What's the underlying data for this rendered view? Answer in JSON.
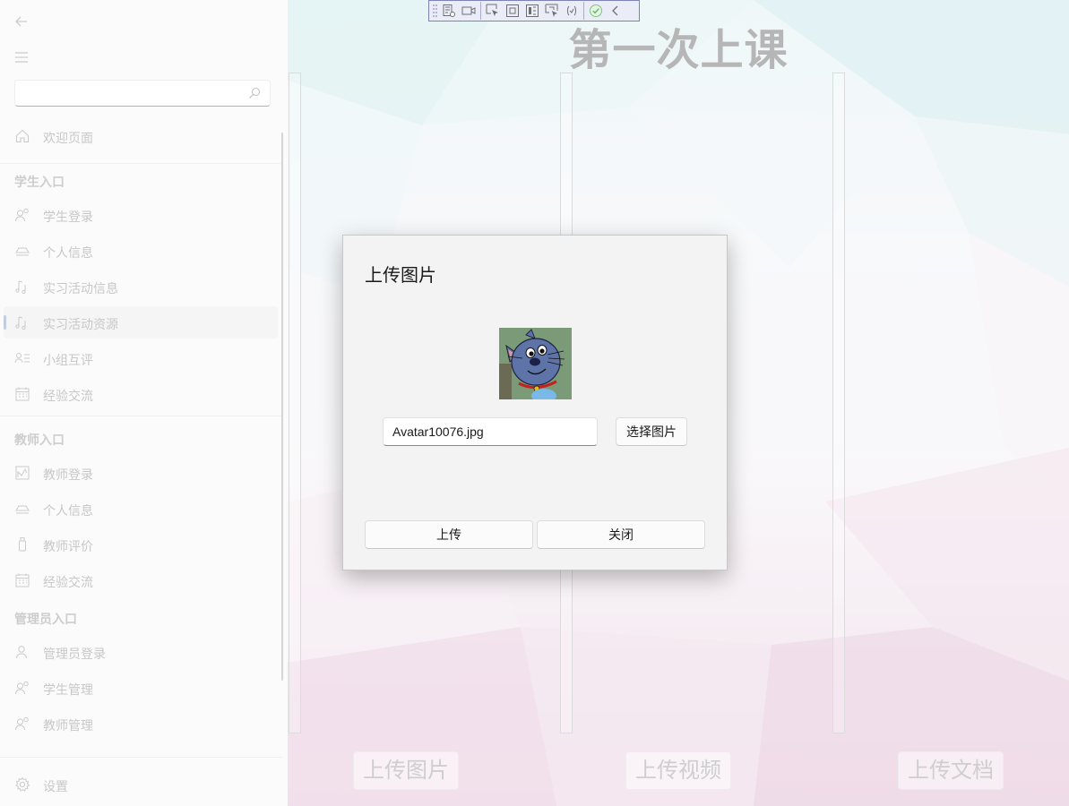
{
  "sidebar": {
    "search_placeholder": "",
    "welcome": "欢迎页面",
    "student_section": "学生入口",
    "student_items": [
      "学生登录",
      "个人信息",
      "实习活动信息",
      "实习活动资源",
      "小组互评",
      "经验交流"
    ],
    "teacher_section": "教师入口",
    "teacher_items": [
      "教师登录",
      "个人信息",
      "教师评价",
      "经验交流"
    ],
    "admin_section": "管理员入口",
    "admin_items": [
      "管理员登录",
      "学生管理",
      "教师管理"
    ],
    "settings": "设置",
    "selected_item": "实习活动资源"
  },
  "main": {
    "title": "第一次上课",
    "upload_image": "上传图片",
    "upload_video": "上传视频",
    "upload_doc": "上传文档"
  },
  "dialog": {
    "title": "上传图片",
    "file_name": "Avatar10076.jpg",
    "choose_label": "选择图片",
    "upload_label": "上传",
    "close_label": "关闭"
  },
  "toolbar": {
    "icons": [
      "grip-icon",
      "live-visual-tree-icon",
      "video-icon",
      "select-element-icon",
      "display-layout-adorners-icon",
      "track-focus-icon",
      "preview-selection-icon",
      "binding-failures-icon",
      "hot-reload-ok-icon",
      "collapse-chevron-icon"
    ]
  },
  "colors": {
    "sidebar_bg": "#f9f9f9",
    "selected_indicator": "#9eb4cf",
    "dialog_bg": "#f3f3f3",
    "toolbar_bg": "#dfe4f4",
    "toolbar_border": "#3a3f8f",
    "ok_green": "#3aa63a"
  }
}
